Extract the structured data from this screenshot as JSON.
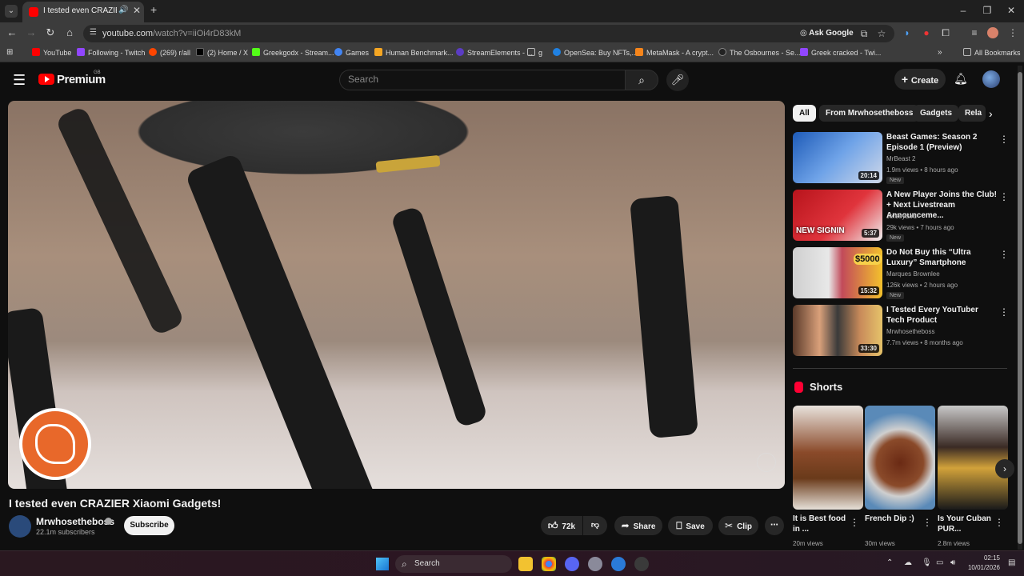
{
  "browser": {
    "tab_title": "I tested even CRAZIER Xiaomi Gadgets!",
    "url_host": "youtube.com",
    "url_path": "/watch?v=iiOi4rD83kM",
    "ask_google": "Ask Google",
    "bookmarks": [
      {
        "label": "YouTube",
        "color": "#ff0000"
      },
      {
        "label": "Following - Twitch",
        "color": "#9146ff"
      },
      {
        "label": "(269) r/all",
        "color": "#ff4500"
      },
      {
        "label": "(2) Home / X",
        "color": "#000000"
      },
      {
        "label": "Greekgodx - Stream...",
        "color": "#53fc18"
      },
      {
        "label": "Games",
        "color": "#4285f4"
      },
      {
        "label": "Human Benchmark...",
        "color": "#f5a623"
      },
      {
        "label": "StreamElements - ...",
        "color": "#5b3cc4"
      },
      {
        "label": "g",
        "color": "#888888"
      },
      {
        "label": "OpenSea: Buy NFTs,...",
        "color": "#2081e2"
      },
      {
        "label": "MetaMask - A crypt...",
        "color": "#f6851b"
      },
      {
        "label": "The Osbournes - Se...",
        "color": "#222222"
      },
      {
        "label": "Greek cracked - Twi...",
        "color": "#9146ff"
      }
    ],
    "all_bookmarks": "All Bookmarks"
  },
  "masthead": {
    "logo_text": "Premium",
    "region": "GB",
    "search_placeholder": "Search",
    "create_label": "Create"
  },
  "video": {
    "title": "I tested even CRAZIER Xiaomi Gadgets!",
    "channel": "Mrwhosetheboss",
    "subscribers": "22.1m subscribers",
    "subscribe_label": "Subscribe",
    "likes": "72k",
    "share_label": "Share",
    "save_label": "Save",
    "clip_label": "Clip"
  },
  "sidebar": {
    "chips": [
      "All",
      "From Mrwhosetheboss",
      "Gadgets",
      "Rela"
    ],
    "recommendations": [
      {
        "title": "Beast Games: Season 2 Episode 1 (Preview)",
        "channel": "MrBeast 2",
        "meta": "1.9m views • 8 hours ago",
        "badge": "New",
        "duration": "20:14"
      },
      {
        "title": "A New Player Joins the Club! + Next Livestream Announceme...",
        "channel": "JerseyBird",
        "meta": "29k views • 7 hours ago",
        "badge": "New",
        "duration": "5:37"
      },
      {
        "title": "Do Not Buy this “Ultra Luxury” Smartphone",
        "channel": "Marques Brownlee",
        "meta": "126k views • 2 hours ago",
        "badge": "New",
        "duration": "15:32"
      },
      {
        "title": "I Tested Every YouTuber Tech Product",
        "channel": "Mrwhosetheboss",
        "meta": "7.7m views • 8 months ago",
        "badge": "",
        "duration": "33:30"
      }
    ],
    "shorts_label": "Shorts",
    "shorts": [
      {
        "title": "It is Best food in ...",
        "views": "20m views"
      },
      {
        "title": "French Dip :)",
        "views": "30m views"
      },
      {
        "title": "Is Your Cuban PUR...",
        "views": "2.8m views"
      }
    ]
  },
  "taskbar": {
    "search_label": "Search",
    "time": "02:15",
    "date": "10/01/2026"
  }
}
